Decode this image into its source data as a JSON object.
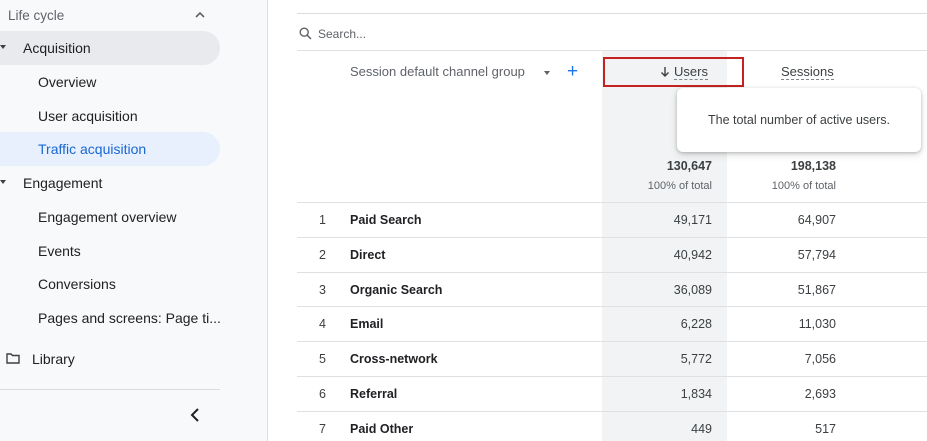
{
  "sidebar": {
    "header": "Life cycle",
    "sections": [
      {
        "label": "Acquisition",
        "items": [
          "Overview",
          "User acquisition",
          "Traffic acquisition"
        ]
      },
      {
        "label": "Engagement",
        "items": [
          "Engagement overview",
          "Events",
          "Conversions",
          "Pages and screens: Page ti..."
        ]
      }
    ],
    "library": "Library",
    "selected_item": "Traffic acquisition"
  },
  "search": {
    "placeholder": "Search..."
  },
  "table": {
    "dimension_header": "Session default channel group",
    "add_symbol": "+",
    "columns": {
      "users": "Users",
      "sessions": "Sessions"
    },
    "sort_column": "Users",
    "tooltip": "The total number of active users.",
    "totals": {
      "users": "130,647",
      "users_pct": "100% of total",
      "sessions": "198,138",
      "sessions_pct": "100% of total"
    },
    "rows": [
      {
        "rank": "1",
        "channel": "Paid Search",
        "users": "49,171",
        "sessions": "64,907"
      },
      {
        "rank": "2",
        "channel": "Direct",
        "users": "40,942",
        "sessions": "57,794"
      },
      {
        "rank": "3",
        "channel": "Organic Search",
        "users": "36,089",
        "sessions": "51,867"
      },
      {
        "rank": "4",
        "channel": "Email",
        "users": "6,228",
        "sessions": "11,030"
      },
      {
        "rank": "5",
        "channel": "Cross-network",
        "users": "5,772",
        "sessions": "7,056"
      },
      {
        "rank": "6",
        "channel": "Referral",
        "users": "1,834",
        "sessions": "2,693"
      },
      {
        "rank": "7",
        "channel": "Paid Other",
        "users": "449",
        "sessions": "517"
      }
    ]
  },
  "colors": {
    "accent": "#1a73e8",
    "highlight_border": "#c5221f",
    "selected_bg": "#e8f0fe"
  }
}
